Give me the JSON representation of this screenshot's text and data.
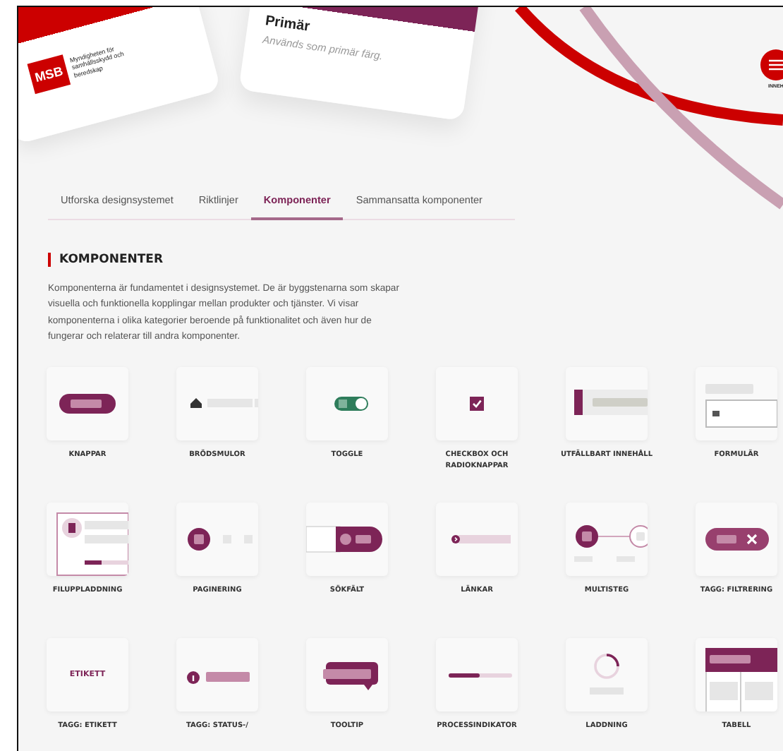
{
  "hero": {
    "logo_card": {
      "logo_text": "MSB",
      "org_name": "Myndigheten för samhällsskydd och beredskap"
    },
    "color_card": {
      "title": "Primär",
      "description": "Används som primär färg."
    },
    "menu_button": {
      "label": "INNEH"
    }
  },
  "tabs": [
    {
      "label": "Utforska designsystemet",
      "selected": false
    },
    {
      "label": "Riktlinjer",
      "selected": false
    },
    {
      "label": "Komponenter",
      "selected": true
    },
    {
      "label": "Sammansatta komponenter",
      "selected": false
    }
  ],
  "section": {
    "heading": "KOMPONENTER",
    "intro": "Komponenterna är fundamentet i designsystemet. De är byggstenarna som skapar visuella och funktionella kopplingar mellan produkter och tjänster. Vi visar komponenterna i olika kategorier beroende på funktionalitet och även hur de fungerar och relaterar till andra komponenter."
  },
  "components": [
    {
      "kind": "button",
      "title": "KNAPPAR"
    },
    {
      "kind": "breadcrumb",
      "title": "BRÖDSMULOR"
    },
    {
      "kind": "toggle",
      "title": "TOGGLE"
    },
    {
      "kind": "checkbox",
      "title": "CHECKBOX OCH RADIOKNAPPAR"
    },
    {
      "kind": "expandable",
      "title": "UTFÄLLBART INNEHÅLL"
    },
    {
      "kind": "form",
      "title": "FORMULÄR"
    },
    {
      "kind": "fileupload",
      "title": "FILUPPLADDNING"
    },
    {
      "kind": "pagination",
      "title": "PAGINERING"
    },
    {
      "kind": "search",
      "title": "SÖKFÄLT"
    },
    {
      "kind": "link",
      "title": "LÄNKAR"
    },
    {
      "kind": "multistep",
      "title": "MULTISTEG"
    },
    {
      "kind": "filtertag",
      "title": "TAGG: FILTRERING"
    },
    {
      "kind": "label",
      "title": "TAGG: ETIKETT",
      "preview_text": "ETIKETT"
    },
    {
      "kind": "statustag",
      "title": "TAGG: STATUS-/"
    },
    {
      "kind": "tooltip",
      "title": "TOOLTIP"
    },
    {
      "kind": "progress",
      "title": "PROCESSINDIKATOR"
    },
    {
      "kind": "loading",
      "title": "LADDNING"
    },
    {
      "kind": "table",
      "title": "TABELL"
    }
  ]
}
